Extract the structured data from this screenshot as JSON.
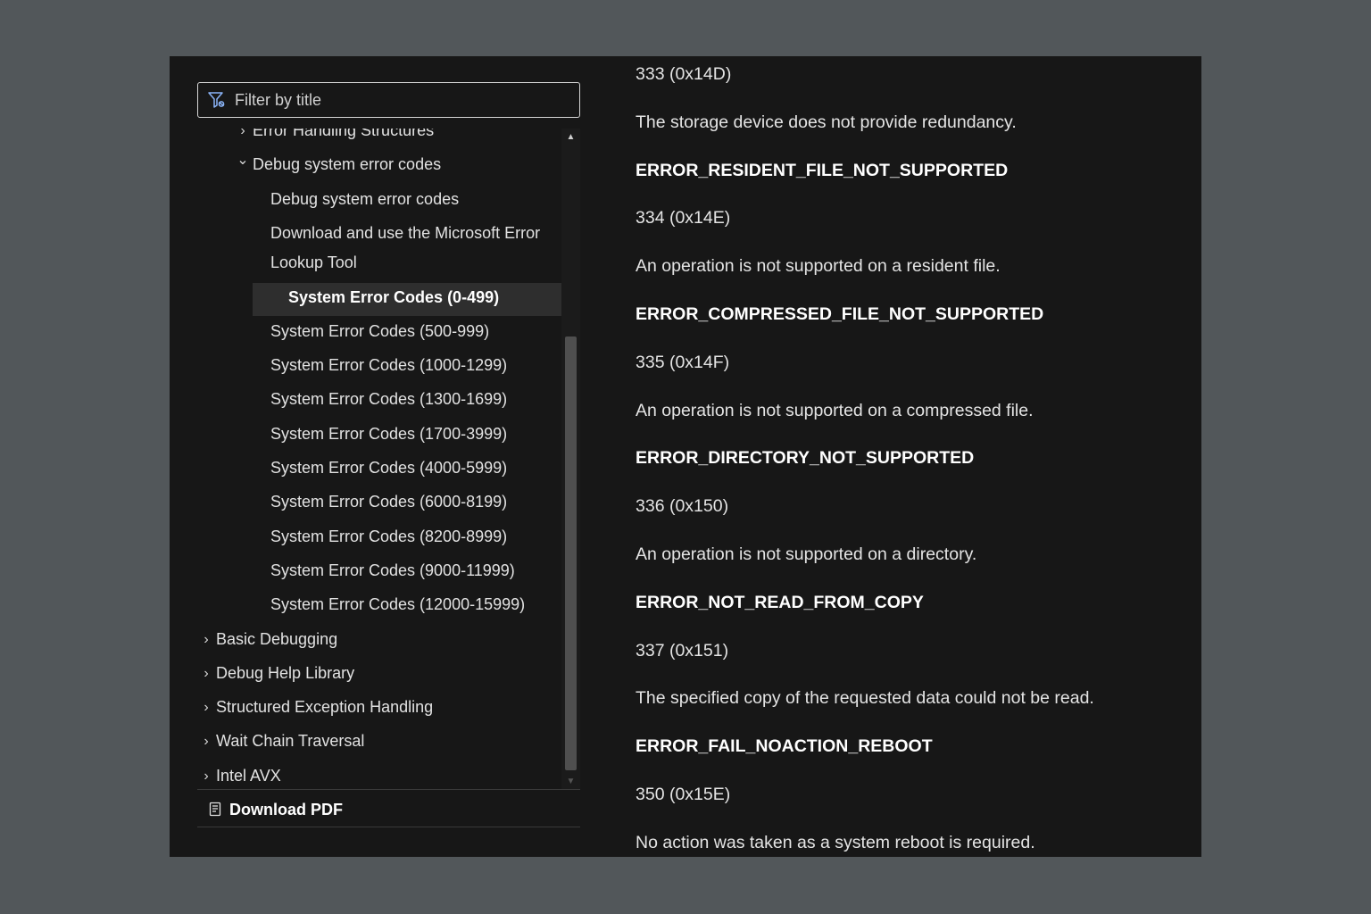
{
  "filter": {
    "placeholder": "Filter by title"
  },
  "tree": [
    {
      "label": "Error Handling Structures",
      "chevron": "›",
      "level": 1
    },
    {
      "label": "Debug system error codes",
      "chevron": "⌄",
      "level": 1
    },
    {
      "label": "Debug system error codes",
      "level": 2
    },
    {
      "label": "Download and use the Microsoft Error",
      "level": 2
    },
    {
      "label": "Lookup Tool",
      "level": 2
    },
    {
      "label": "System Error Codes (0-499)",
      "level": 2,
      "selected": true
    },
    {
      "label": "System Error Codes (500-999)",
      "level": 2
    },
    {
      "label": "System Error Codes (1000-1299)",
      "level": 2
    },
    {
      "label": "System Error Codes (1300-1699)",
      "level": 2
    },
    {
      "label": "System Error Codes (1700-3999)",
      "level": 2
    },
    {
      "label": "System Error Codes (4000-5999)",
      "level": 2
    },
    {
      "label": "System Error Codes (6000-8199)",
      "level": 2
    },
    {
      "label": "System Error Codes (8200-8999)",
      "level": 2
    },
    {
      "label": "System Error Codes (9000-11999)",
      "level": 2
    },
    {
      "label": "System Error Codes (12000-15999)",
      "level": 2
    },
    {
      "label": "Basic Debugging",
      "chevron": "›",
      "level": 0
    },
    {
      "label": "Debug Help Library",
      "chevron": "›",
      "level": 0
    },
    {
      "label": "Structured Exception Handling",
      "chevron": "›",
      "level": 0
    },
    {
      "label": "Wait Chain Traversal",
      "chevron": "›",
      "level": 0
    },
    {
      "label": "Intel AVX",
      "chevron": "›",
      "level": 0
    }
  ],
  "download_pdf": {
    "label": "Download PDF"
  },
  "content": [
    {
      "text": "333 (0x14D)",
      "kind": "code"
    },
    {
      "text": "The storage device does not provide redundancy.",
      "kind": "desc"
    },
    {
      "text": "ERROR_RESIDENT_FILE_NOT_SUPPORTED",
      "kind": "const"
    },
    {
      "text": "334 (0x14E)",
      "kind": "code"
    },
    {
      "text": "An operation is not supported on a resident file.",
      "kind": "desc"
    },
    {
      "text": "ERROR_COMPRESSED_FILE_NOT_SUPPORTED",
      "kind": "const"
    },
    {
      "text": "335 (0x14F)",
      "kind": "code"
    },
    {
      "text": "An operation is not supported on a compressed file.",
      "kind": "desc"
    },
    {
      "text": "ERROR_DIRECTORY_NOT_SUPPORTED",
      "kind": "const"
    },
    {
      "text": "336 (0x150)",
      "kind": "code"
    },
    {
      "text": "An operation is not supported on a directory.",
      "kind": "desc"
    },
    {
      "text": "ERROR_NOT_READ_FROM_COPY",
      "kind": "const"
    },
    {
      "text": "337 (0x151)",
      "kind": "code"
    },
    {
      "text": "The specified copy of the requested data could not be read.",
      "kind": "desc"
    },
    {
      "text": "ERROR_FAIL_NOACTION_REBOOT",
      "kind": "const"
    },
    {
      "text": "350 (0x15E)",
      "kind": "code"
    },
    {
      "text": "No action was taken as a system reboot is required.",
      "kind": "desc"
    }
  ]
}
